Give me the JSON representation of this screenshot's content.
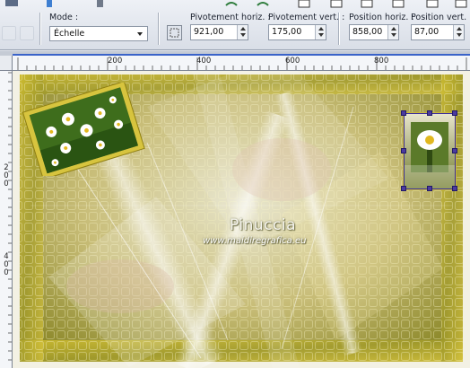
{
  "options_bar": {
    "mode_label": "Mode :",
    "mode_value": "Échelle",
    "pivot_h_label": "Pivotement horiz. :",
    "pivot_h_value": "921,00",
    "pivot_v_label": "Pivotement vert. :",
    "pivot_v_value": "175,00",
    "pos_h_label": "Position horiz. :",
    "pos_h_value": "858,00",
    "pos_v_label": "Position vert. :",
    "pos_v_value": "87,00"
  },
  "ruler": {
    "horizontal_labels": [
      "200",
      "400",
      "600",
      "800"
    ],
    "vertical_labels": [
      "2",
      "0",
      "0",
      "4",
      "0",
      "0"
    ]
  },
  "canvas": {
    "watermark_title": "Pinuccia",
    "watermark_url": "www.maidiregrafica.eu"
  },
  "colors": {
    "accent": "#3a63c9",
    "canvas_gold": "#c9b93a",
    "handle": "#4b3aa0"
  }
}
